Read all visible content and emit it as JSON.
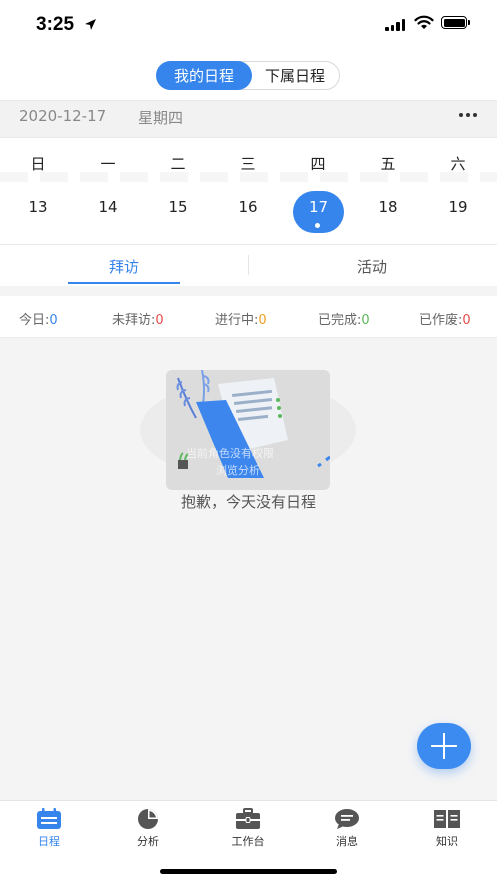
{
  "status_bar": {
    "time": "3:25"
  },
  "header": {
    "segments": [
      {
        "label": "我的日程",
        "active": true
      },
      {
        "label": "下属日程",
        "active": false
      }
    ]
  },
  "date_bar": {
    "date": "2020-12-17",
    "weekday": "星期四"
  },
  "calendar": {
    "weekdays": [
      "日",
      "一",
      "二",
      "三",
      "四",
      "五",
      "六"
    ],
    "days": [
      "13",
      "14",
      "15",
      "16",
      "17",
      "18",
      "19"
    ],
    "selected_day": "17"
  },
  "tabs": [
    {
      "label": "拜访",
      "active": true
    },
    {
      "label": "活动",
      "active": false
    }
  ],
  "stats": [
    {
      "label": "今日:",
      "value": "0",
      "color": "#3585ec"
    },
    {
      "label": "未拜访:",
      "value": "0",
      "color": "#e84a4a"
    },
    {
      "label": "进行中:",
      "value": "0",
      "color": "#f0a020"
    },
    {
      "label": "已完成:",
      "value": "0",
      "color": "#5cb85c"
    },
    {
      "label": "已作废:",
      "value": "0",
      "color": "#e84a4a"
    }
  ],
  "empty_state": {
    "illustration_text_1": "当前角色没有权限",
    "illustration_text_2": "浏览分析",
    "message": "抱歉，今天没有日程"
  },
  "bottom_nav": [
    {
      "label": "日程",
      "icon": "calendar-list-icon",
      "active": true
    },
    {
      "label": "分析",
      "icon": "pie-chart-icon",
      "active": false
    },
    {
      "label": "工作台",
      "icon": "briefcase-icon",
      "active": false
    },
    {
      "label": "消息",
      "icon": "chat-bubble-icon",
      "active": false
    },
    {
      "label": "知识",
      "icon": "book-icon",
      "active": false
    }
  ],
  "colors": {
    "accent": "#3585ec"
  }
}
